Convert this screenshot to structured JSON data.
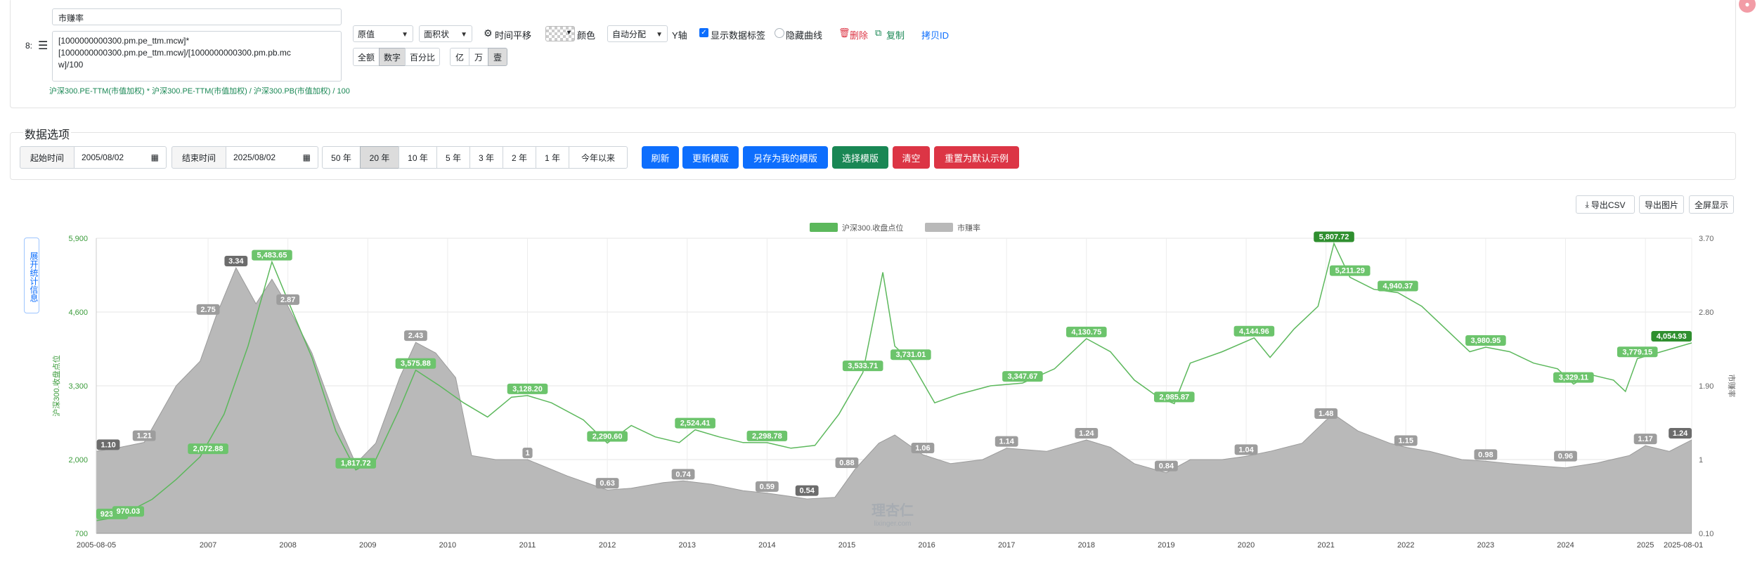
{
  "editor": {
    "row_index": "8:",
    "name_value": "市赚率",
    "formula_line1": "[1000000000300.pm.pe_ttm.mcw]*",
    "formula_line2": "[1000000000300.pm.pe_ttm.mcw]/[1000000000300.pm.pb.mc",
    "formula_line3": "w]/100",
    "formula_desc": "沪深300.PE-TTM(市值加权) * 沪深300.PE-TTM(市值加权) / 沪深300.PB(市值加权) / 100",
    "value_type": "原值",
    "chart_style": "面积状",
    "time_shift": "时间平移",
    "color_label": "颜色",
    "y_axis_select": "自动分配",
    "y_axis_label": "Y轴",
    "show_labels": "显示数据标签",
    "hide_curve": "隐藏曲线",
    "delete": "删除",
    "copy": "复制",
    "copy_id": "拷贝ID",
    "fmt_buttons": [
      "全额",
      "数字",
      "百分比"
    ],
    "unit_buttons": [
      "亿",
      "万",
      "壹"
    ]
  },
  "options": {
    "title": "数据选项",
    "start_label": "起始时间",
    "start_value": "2005/08/02",
    "end_label": "结束时间",
    "end_value": "2025/08/02",
    "ranges": [
      "50 年",
      "20 年",
      "10 年",
      "5 年",
      "3 年",
      "2 年",
      "1 年",
      "今年以来"
    ],
    "active_range": "20 年",
    "refresh": "刷新",
    "update_tpl": "更新模版",
    "save_tpl": "另存为我的模版",
    "choose_tpl": "选择模版",
    "clear": "清空",
    "reset": "重置为默认示例"
  },
  "toolbar": {
    "export_csv": "导出CSV",
    "export_img": "导出图片",
    "fullscreen": "全屏显示",
    "side_tab": "展开统计信息"
  },
  "colors": {
    "green": "#5cb85c",
    "green_dark": "#3a9b3a",
    "gray_area": "#b9b9b9",
    "gray_label": "#8c8c8c",
    "blue": "#0d6efd",
    "teal_green": "#198754",
    "red": "#dc3545"
  },
  "chart_data": {
    "type": "line",
    "legend": [
      "沪深300.收盘点位",
      "市赚率"
    ],
    "legend_position": "top-center",
    "ylabel_left": "沪深300.收盘点位",
    "ylabel_right": "市赚率",
    "left_ticks": [
      "5,900",
      "4,600",
      "3,300",
      "2,000",
      "700"
    ],
    "left_range": [
      700,
      5900
    ],
    "right_ticks": [
      "3.70",
      "2.80",
      "1.90",
      "1",
      "0.10"
    ],
    "right_range": [
      0.1,
      3.7
    ],
    "x_ticks": [
      "2005-08-05",
      "2007",
      "2008",
      "2009",
      "2010",
      "2011",
      "2012",
      "2013",
      "2014",
      "2015",
      "2016",
      "2017",
      "2018",
      "2019",
      "2020",
      "2021",
      "2022",
      "2023",
      "2024",
      "2025",
      "2025-08-01"
    ],
    "x_range": [
      2005.6,
      2025.58
    ],
    "grid": true,
    "watermark": "理杏仁",
    "watermark_sub": "lixinger.com",
    "series": [
      {
        "name": "沪深300.收盘点位",
        "axis": "left",
        "x": [
          2005.6,
          2005.8,
          2006.0,
          2006.3,
          2006.6,
          2006.9,
          2007.2,
          2007.5,
          2007.8,
          2008.0,
          2008.3,
          2008.6,
          2008.85,
          2009.1,
          2009.4,
          2009.6,
          2009.9,
          2010.2,
          2010.5,
          2010.8,
          2011.0,
          2011.3,
          2011.7,
          2012.0,
          2012.3,
          2012.6,
          2012.9,
          2013.1,
          2013.4,
          2013.7,
          2014.0,
          2014.3,
          2014.6,
          2014.9,
          2015.2,
          2015.45,
          2015.6,
          2015.8,
          2016.1,
          2016.4,
          2016.8,
          2017.2,
          2017.6,
          2018.0,
          2018.3,
          2018.6,
          2018.9,
          2019.1,
          2019.3,
          2019.7,
          2020.1,
          2020.3,
          2020.6,
          2020.9,
          2021.1,
          2021.3,
          2021.6,
          2021.9,
          2022.2,
          2022.5,
          2022.8,
          2023.0,
          2023.3,
          2023.6,
          2023.9,
          2024.1,
          2024.3,
          2024.6,
          2024.75,
          2024.9,
          2025.2,
          2025.58
        ],
        "values": [
          923.8,
          970,
          1080,
          1300,
          1650,
          2050,
          2800,
          4000,
          5483.65,
          4800,
          3800,
          2500,
          1817.72,
          2000,
          2900,
          3575.88,
          3300,
          3000,
          2750,
          3100,
          3128.2,
          3000,
          2700,
          2290.6,
          2600,
          2400,
          2300,
          2524.41,
          2400,
          2300,
          2298.78,
          2200,
          2250,
          2800,
          3533.71,
          5300,
          4000,
          3731.01,
          3000,
          3150,
          3300,
          3347.67,
          3600,
          4130.75,
          3900,
          3400,
          3100,
          2985.87,
          3700,
          3900,
          4144.96,
          3800,
          4300,
          4700,
          5807.72,
          5211.29,
          5000,
          4940.37,
          4700,
          4300,
          3900,
          3980.95,
          3900,
          3700,
          3600,
          3329.11,
          3500,
          3400,
          3200,
          3779.15,
          3900,
          4054.93
        ]
      },
      {
        "name": "市赚率",
        "axis": "right",
        "x": [
          2005.6,
          2005.9,
          2006.2,
          2006.6,
          2006.9,
          2007.1,
          2007.35,
          2007.6,
          2007.8,
          2008.0,
          2008.3,
          2008.6,
          2008.85,
          2009.1,
          2009.4,
          2009.6,
          2009.85,
          2010.1,
          2010.3,
          2010.6,
          2011.0,
          2011.5,
          2012.0,
          2012.3,
          2012.7,
          2012.95,
          2013.3,
          2013.7,
          2014.0,
          2014.3,
          2014.5,
          2014.85,
          2015.1,
          2015.4,
          2015.6,
          2015.95,
          2016.3,
          2016.7,
          2017.0,
          2017.5,
          2018.0,
          2018.3,
          2018.6,
          2019.0,
          2019.3,
          2019.7,
          2020.0,
          2020.3,
          2020.7,
          2021.0,
          2021.1,
          2021.4,
          2021.8,
          2022.0,
          2022.3,
          2022.7,
          2023.0,
          2023.3,
          2023.7,
          2024.0,
          2024.4,
          2024.8,
          2025.0,
          2025.3,
          2025.58
        ],
        "values": [
          1.1,
          1.15,
          1.21,
          1.9,
          2.2,
          2.75,
          3.34,
          2.9,
          3.2,
          2.87,
          2.3,
          1.5,
          0.95,
          1.2,
          2.0,
          2.43,
          2.3,
          2.0,
          1.05,
          1.0,
          1.0,
          0.8,
          0.63,
          0.65,
          0.72,
          0.74,
          0.7,
          0.62,
          0.59,
          0.55,
          0.52,
          0.54,
          0.88,
          1.2,
          1.3,
          1.06,
          0.95,
          1.0,
          1.14,
          1.1,
          1.24,
          1.15,
          0.95,
          0.84,
          1.0,
          1.0,
          1.04,
          1.1,
          1.2,
          1.48,
          1.55,
          1.35,
          1.2,
          1.15,
          1.1,
          1.0,
          0.98,
          0.95,
          0.92,
          0.9,
          0.96,
          1.05,
          1.17,
          1.1,
          1.24
        ]
      }
    ],
    "labels_left": [
      {
        "x": 2005.6,
        "v": 923.8,
        "t": "923.80"
      },
      {
        "x": 2006.0,
        "v": 970.03,
        "t": "970.03"
      },
      {
        "x": 2007.0,
        "v": 2072.88,
        "t": "2,072.88"
      },
      {
        "x": 2007.8,
        "v": 5483.65,
        "t": "5,483.65"
      },
      {
        "x": 2008.85,
        "v": 1817.72,
        "t": "1,817.72"
      },
      {
        "x": 2009.6,
        "v": 3575.88,
        "t": "3,575.88"
      },
      {
        "x": 2011.0,
        "v": 3128.2,
        "t": "3,128.20"
      },
      {
        "x": 2012.0,
        "v": 2290.6,
        "t": "2,290.60"
      },
      {
        "x": 2013.1,
        "v": 2524.41,
        "t": "2,524.41"
      },
      {
        "x": 2014.0,
        "v": 2298.78,
        "t": "2,298.78"
      },
      {
        "x": 2015.2,
        "v": 3533.71,
        "t": "3,533.71"
      },
      {
        "x": 2015.8,
        "v": 3731.01,
        "t": "3,731.01"
      },
      {
        "x": 2017.2,
        "v": 3347.67,
        "t": "3,347.67"
      },
      {
        "x": 2018.0,
        "v": 4130.75,
        "t": "4,130.75"
      },
      {
        "x": 2019.1,
        "v": 2985.87,
        "t": "2,985.87"
      },
      {
        "x": 2020.1,
        "v": 4144.96,
        "t": "4,144.96"
      },
      {
        "x": 2021.1,
        "v": 5807.72,
        "t": "5,807.72",
        "dark": true
      },
      {
        "x": 2021.3,
        "v": 5211.29,
        "t": "5,211.29"
      },
      {
        "x": 2021.9,
        "v": 4940.37,
        "t": "4,940.37"
      },
      {
        "x": 2023.0,
        "v": 3980.95,
        "t": "3,980.95"
      },
      {
        "x": 2024.1,
        "v": 3329.11,
        "t": "3,329.11"
      },
      {
        "x": 2024.9,
        "v": 3779.15,
        "t": "3,779.15"
      },
      {
        "x": 2025.5,
        "v": 4054.93,
        "t": "4,054.93",
        "dark": true
      }
    ],
    "labels_right": [
      {
        "x": 2005.75,
        "v": 1.1,
        "t": "1.10",
        "dark": true
      },
      {
        "x": 2006.2,
        "v": 1.21,
        "t": "1.21"
      },
      {
        "x": 2007.0,
        "v": 2.75,
        "t": "2.75"
      },
      {
        "x": 2007.35,
        "v": 3.34,
        "t": "3.34",
        "dark": true
      },
      {
        "x": 2008.0,
        "v": 2.87,
        "t": "2.87"
      },
      {
        "x": 2009.6,
        "v": 2.43,
        "t": "2.43"
      },
      {
        "x": 2011.0,
        "v": 1.0,
        "t": "1"
      },
      {
        "x": 2012.0,
        "v": 0.63,
        "t": "0.63"
      },
      {
        "x": 2012.95,
        "v": 0.74,
        "t": "0.74"
      },
      {
        "x": 2014.0,
        "v": 0.59,
        "t": "0.59"
      },
      {
        "x": 2014.5,
        "v": 0.54,
        "t": "0.54",
        "dark": true
      },
      {
        "x": 2015.0,
        "v": 0.88,
        "t": "0.88"
      },
      {
        "x": 2015.95,
        "v": 1.06,
        "t": "1.06"
      },
      {
        "x": 2017.0,
        "v": 1.14,
        "t": "1.14"
      },
      {
        "x": 2018.0,
        "v": 1.24,
        "t": "1.24"
      },
      {
        "x": 2019.0,
        "v": 0.84,
        "t": "0.84"
      },
      {
        "x": 2020.0,
        "v": 1.04,
        "t": "1.04"
      },
      {
        "x": 2021.0,
        "v": 1.48,
        "t": "1.48"
      },
      {
        "x": 2022.0,
        "v": 1.15,
        "t": "1.15"
      },
      {
        "x": 2023.0,
        "v": 0.98,
        "t": "0.98"
      },
      {
        "x": 2024.0,
        "v": 0.96,
        "t": "0.96"
      },
      {
        "x": 2025.0,
        "v": 1.17,
        "t": "1.17"
      },
      {
        "x": 2025.5,
        "v": 1.24,
        "t": "1.24",
        "dark": true
      }
    ]
  }
}
